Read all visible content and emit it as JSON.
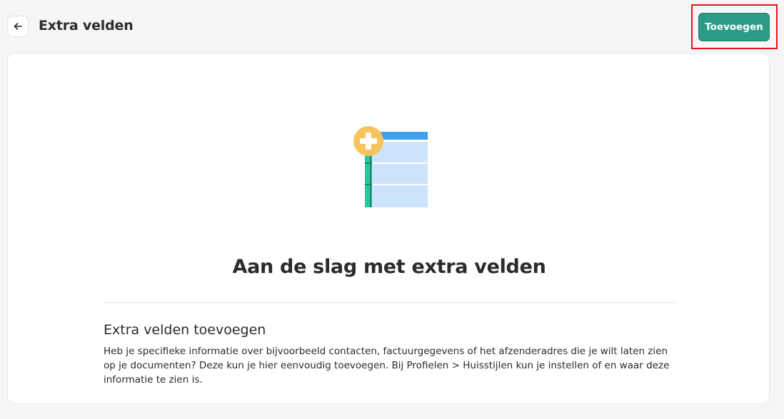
{
  "header": {
    "title": "Extra velden",
    "add_label": "Toevoegen"
  },
  "empty_state": {
    "title": "Aan de slag met extra velden",
    "section_heading": "Extra velden toevoegen",
    "section_body": "Heb je specifieke informatie over bijvoorbeeld contacten, factuurgegevens of het afzenderadres die je wilt laten zien op je documenten? Deze kun je hier eenvoudig toevoegen. Bij Profielen > Huisstijlen kun je instellen of en waar deze informatie te zien is."
  },
  "colors": {
    "accent": "#2d9c87",
    "highlight": "#e0161c",
    "plus_circle": "#f8c35a",
    "table_header": "#3fa0f0",
    "table_body": "#cce4fb",
    "table_side": "#2ec4a0"
  },
  "icons": {
    "back": "arrow-left-icon",
    "illustration": "table-add-illustration"
  }
}
